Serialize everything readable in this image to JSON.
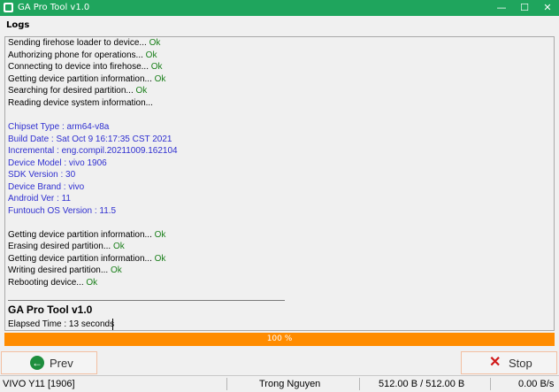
{
  "window": {
    "title": "GA Pro Tool v1.0",
    "minimize": "—",
    "maximize": "☐",
    "close": "✕"
  },
  "logs_label": "Logs",
  "log_lines": [
    {
      "text": "Sending firehose loader to device...",
      "status": "Ok"
    },
    {
      "text": "Authorizing phone for operations...",
      "status": "Ok"
    },
    {
      "text": "Connecting to device into firehose...",
      "status": "Ok"
    },
    {
      "text": "Getting device partition information...",
      "status": "Ok"
    },
    {
      "text": "Searching for desired partition...",
      "status": "Ok"
    },
    {
      "text": "Reading device system information...",
      "status": ""
    }
  ],
  "device_info": [
    "Chipset Type : arm64-v8a",
    "Build Date : Sat Oct  9 16:17:35 CST 2021",
    "Incremental : eng.compil.20211009.162104",
    "Device Model : vivo 1906",
    "SDK Version : 30",
    "Device Brand : vivo",
    "Android Ver : 11",
    "Funtouch OS Version : 11.5"
  ],
  "log_lines_2": [
    {
      "text": "Getting device partition information...",
      "status": "Ok"
    },
    {
      "text": "Erasing desired partition...",
      "status": "Ok"
    },
    {
      "text": "Getting device partition information...",
      "status": "Ok"
    },
    {
      "text": "Writing desired partition...",
      "status": "Ok"
    },
    {
      "text": "Rebooting device...",
      "status": "Ok"
    }
  ],
  "summary": {
    "heading": "GA Pro Tool v1.0",
    "elapsed": "Elapsed Time : 13 seconds"
  },
  "progress": {
    "value": 1.0,
    "label": "100 %"
  },
  "buttons": {
    "prev": "Prev",
    "stop": "Stop"
  },
  "status": {
    "device": "VIVO Y11 [1906]",
    "user": "Trong Nguyen",
    "transfer": "512.00 B / 512.00 B",
    "speed": "0.00 B/s"
  },
  "colors": {
    "title_bar": "#1fa55d",
    "progress": "#ff8c00",
    "ok": "#1a7f1a",
    "info": "#2f2fd0"
  }
}
